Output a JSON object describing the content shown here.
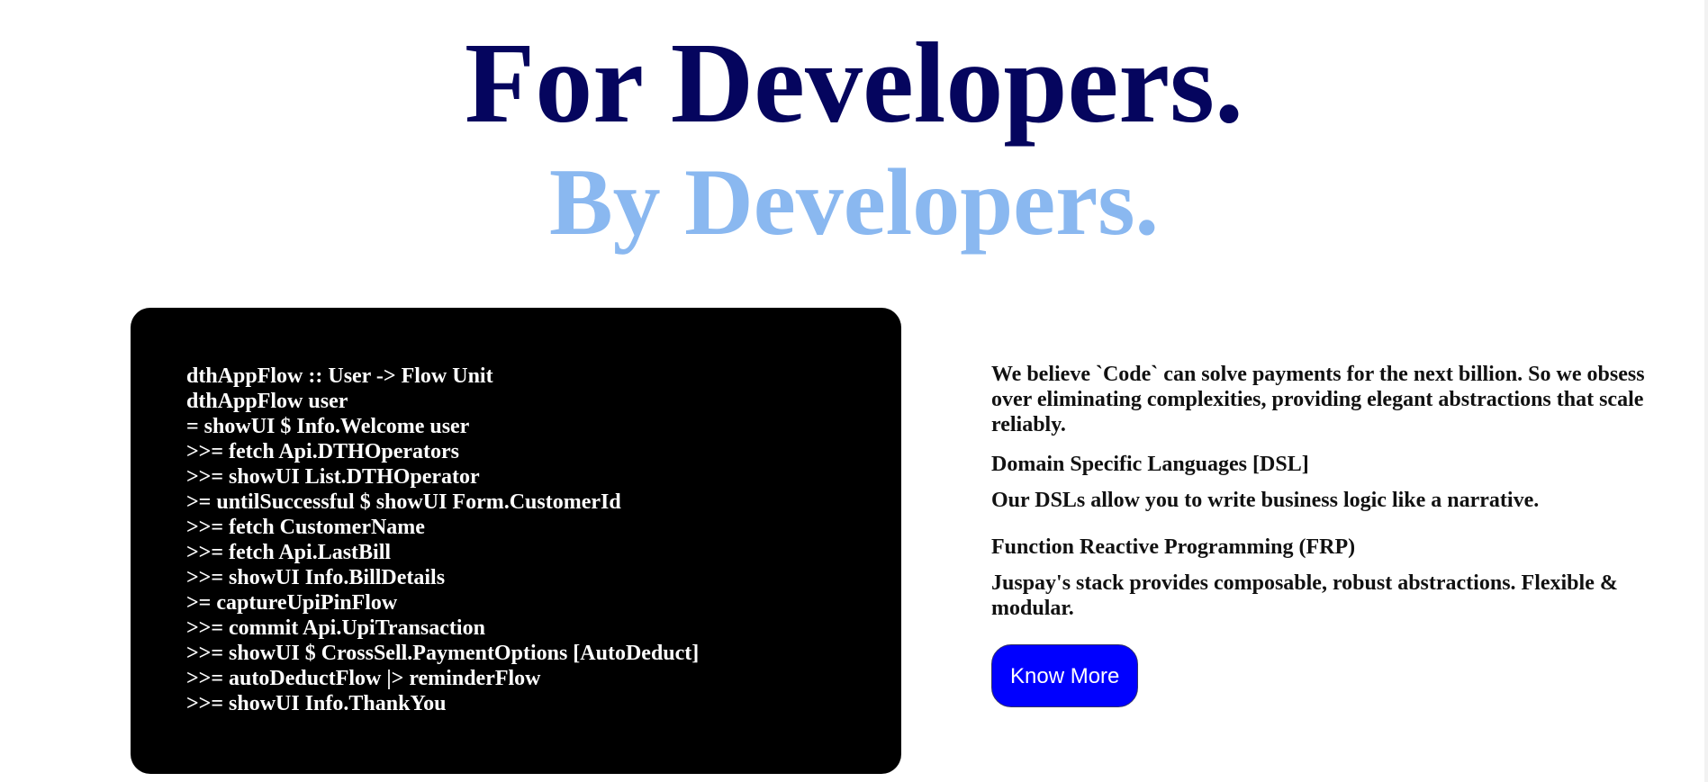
{
  "hero": {
    "title_primary": "For Developers.",
    "title_secondary": "By Developers.",
    "colors": {
      "primary": "#05055e",
      "secondary": "#8ab8f0"
    }
  },
  "code_block": {
    "lines": [
      "dthAppFlow :: User -> Flow Unit",
      "dthAppFlow user",
      "= showUI $ Info.Welcome user",
      ">>= fetch Api.DTHOperators",
      ">>= showUI List.DTHOperator",
      ">= untilSuccessful $ showUI Form.CustomerId",
      ">>= fetch CustomerName",
      ">>= fetch Api.LastBill",
      ">>= showUI Info.BillDetails",
      ">= captureUpiPinFlow",
      ">>= commit Api.UpiTransaction",
      ">>= showUI $ CrossSell.PaymentOptions [AutoDeduct]",
      ">>= autoDeductFlow |> reminderFlow",
      ">>= showUI Info.ThankYou"
    ]
  },
  "info": {
    "intro": "We believe `Code` can solve payments for the next billion. So we obsess over eliminating complexities, providing elegant abstractions that scale reliably.",
    "features": [
      {
        "title": "Domain Specific Languages [DSL]",
        "description": "Our DSLs allow you to write business logic like a narrative."
      },
      {
        "title": "Function Reactive Programming (FRP)",
        "description": "Juspay's stack provides composable, robust abstractions. Flexible & modular."
      }
    ],
    "cta_label": "Know More",
    "cta_color": "#0000ff"
  }
}
